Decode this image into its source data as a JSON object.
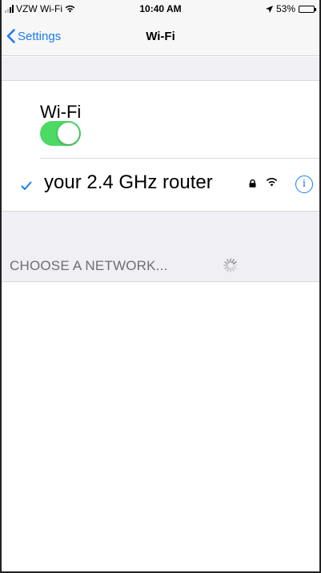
{
  "status_bar": {
    "carrier": "VZW Wi-Fi",
    "time": "10:40 AM",
    "battery_percent": "53%",
    "battery_level": 0.53
  },
  "nav": {
    "back_label": "Settings",
    "title": "Wi-Fi"
  },
  "wifi": {
    "label": "Wi-Fi",
    "enabled": true
  },
  "connected_network": {
    "name": "your 2.4 GHz router",
    "secured": true,
    "icons": [
      "checkmark-icon",
      "lock-icon",
      "wifi-signal-icon",
      "info-icon"
    ]
  },
  "section": {
    "header": "CHOOSE A NETWORK..."
  },
  "colors": {
    "accent": "#1a7cf5",
    "toggle_on": "#4cd964",
    "group_bg": "#efeff4",
    "section_text": "#6d6d72"
  }
}
